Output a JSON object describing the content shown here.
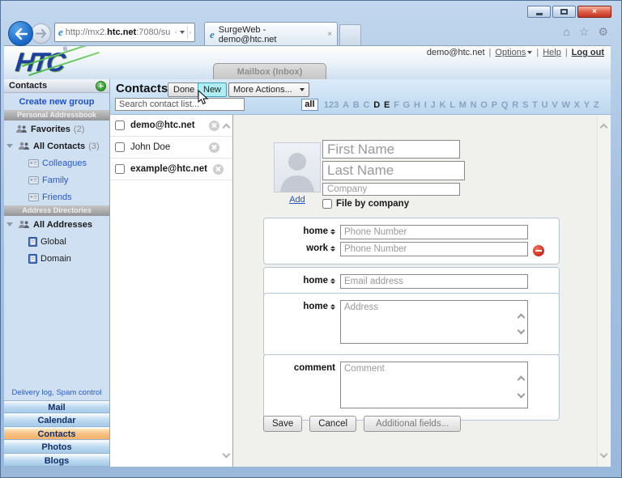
{
  "browser": {
    "url_prefix": "http://mx2.",
    "url_domain": "htc.net",
    "url_suffix": ":7080/su",
    "tab_title": "SurgeWeb - demo@htc.net"
  },
  "icons": {
    "close_x": "×",
    "ie_logo": "e",
    "home": "⌂",
    "star": "☆",
    "gear": "⚙",
    "caret": "▾"
  },
  "account_bar": {
    "email": "demo@htc.net",
    "options": "Options",
    "help": "Help",
    "logout": "Log out",
    "sep": "|"
  },
  "header": {
    "logo": "HTC",
    "reg": "®",
    "mailbox_tab": "Mailbox (Inbox)"
  },
  "sidebar": {
    "title": "Contacts",
    "create_group": "Create new group",
    "personal_header": "Personal Addressbook",
    "items": {
      "favorites": "Favorites",
      "favorites_count": "(2)",
      "all_contacts": "All Contacts",
      "all_contacts_count": "(3)",
      "colleagues": "Colleagues",
      "family": "Family",
      "friends": "Friends"
    },
    "directories_header": "Address Directories",
    "dir_items": {
      "all_addresses": "All Addresses",
      "global": "Global",
      "domain": "Domain"
    },
    "footer_links": {
      "delivery": "Delivery log,",
      "spam": "Spam control"
    },
    "nav": [
      "Mail",
      "Calendar",
      "Contacts",
      "Photos",
      "Blogs"
    ],
    "active_nav": "Contacts"
  },
  "toolbar": {
    "title": "Contacts",
    "done": "Done",
    "new": "New",
    "more_actions": "More Actions...",
    "search_placeholder": "Search contact list...",
    "alphabet": {
      "all": "all",
      "items": [
        "123",
        "A",
        "B",
        "C",
        "D",
        "E",
        "F",
        "G",
        "H",
        "I",
        "J",
        "K",
        "L",
        "M",
        "N",
        "O",
        "P",
        "Q",
        "R",
        "S",
        "T",
        "U",
        "V",
        "W",
        "X",
        "Y",
        "Z"
      ],
      "active": [
        "D",
        "E"
      ]
    }
  },
  "contacts": [
    {
      "name": "demo@htc.net"
    },
    {
      "name": "John Doe"
    },
    {
      "name": "example@htc.net"
    }
  ],
  "form": {
    "add_photo": "Add",
    "first_name_placeholder": "First Name",
    "last_name_placeholder": "Last Name",
    "company_placeholder": "Company",
    "file_by_company": "File by company",
    "phone_rows": [
      {
        "type": "home",
        "placeholder": "Phone Number"
      },
      {
        "type": "work",
        "placeholder": "Phone Number"
      }
    ],
    "email_rows": [
      {
        "type": "home",
        "placeholder": "Email address"
      }
    ],
    "address_rows": [
      {
        "type": "home",
        "placeholder": "Address"
      }
    ],
    "comment_label": "comment",
    "comment_placeholder": "Comment",
    "save": "Save",
    "cancel": "Cancel",
    "additional_fields": "Additional fields..."
  },
  "colors": {
    "nav_active": "#f3b269",
    "new_button": "#aeeef0",
    "link_blue": "#2353c4",
    "remove_red": "#cf2b1e"
  }
}
